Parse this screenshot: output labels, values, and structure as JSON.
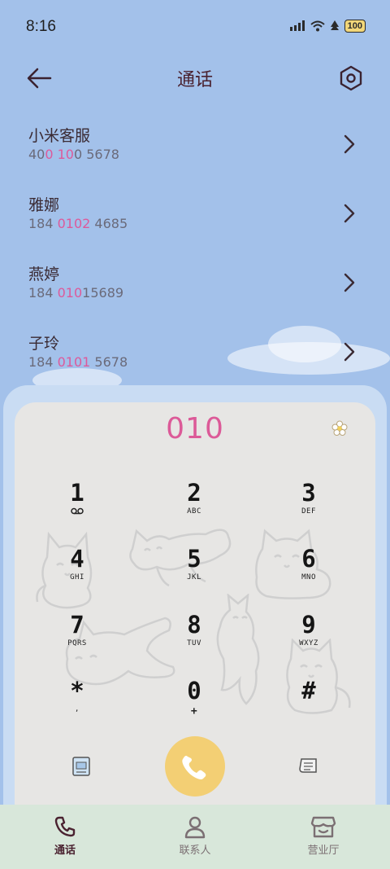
{
  "status_bar": {
    "time": "8:16",
    "battery": "100"
  },
  "header": {
    "title": "通话"
  },
  "contacts": [
    {
      "name": "小米客服",
      "number_parts": [
        "40",
        "0 10",
        "0 5678"
      ]
    },
    {
      "name": "雅娜",
      "number_parts": [
        "184 ",
        "0102",
        " 4685"
      ]
    },
    {
      "name": "燕婷",
      "number_parts": [
        "184 ",
        "010",
        "15689"
      ]
    },
    {
      "name": "子玲",
      "number_parts": [
        "184 ",
        "0101",
        " 5678"
      ]
    }
  ],
  "dialpad": {
    "input": "010",
    "keys": [
      {
        "digit": "1",
        "letters": ""
      },
      {
        "digit": "2",
        "letters": "ABC"
      },
      {
        "digit": "3",
        "letters": "DEF"
      },
      {
        "digit": "4",
        "letters": "GHI"
      },
      {
        "digit": "5",
        "letters": "JKL"
      },
      {
        "digit": "6",
        "letters": "MNO"
      },
      {
        "digit": "7",
        "letters": "PQRS"
      },
      {
        "digit": "8",
        "letters": "TUV"
      },
      {
        "digit": "9",
        "letters": "WXYZ"
      },
      {
        "digit": "*",
        "letters": ","
      },
      {
        "digit": "0",
        "letters": "+"
      },
      {
        "digit": "#",
        "letters": ""
      }
    ]
  },
  "bottom_nav": [
    {
      "label": "通话",
      "icon": "phone-icon",
      "active": true
    },
    {
      "label": "联系人",
      "icon": "person-icon",
      "active": false
    },
    {
      "label": "营业厅",
      "icon": "store-icon",
      "active": false
    }
  ],
  "colors": {
    "background": "#a3c1ea",
    "highlight": "#dd5a9b",
    "call_button": "#f3cf74",
    "nav_background": "#d8e7da",
    "nav_active": "#4a2230",
    "nav_inactive": "#7b6f73"
  }
}
